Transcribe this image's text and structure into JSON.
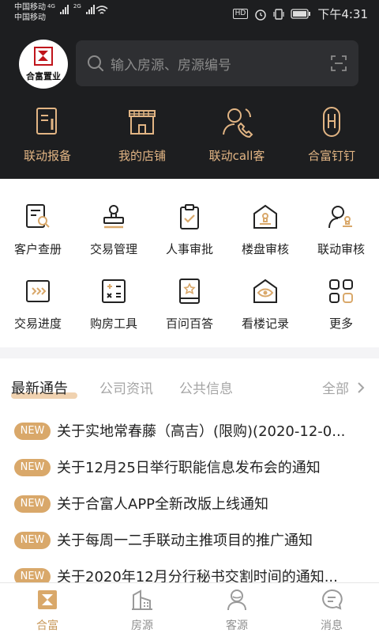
{
  "status_bar": {
    "carrier_1": "中国移动",
    "carrier_2": "中国移动",
    "net_1": "4G",
    "net_2": "2G",
    "hd": "HD",
    "time": "下午4:31"
  },
  "header": {
    "logo_text": "合富置业",
    "search_placeholder": "输入房源、房源编号",
    "quick_actions": [
      {
        "label": "联动报备",
        "icon": "report-icon"
      },
      {
        "label": "我的店铺",
        "icon": "store-icon"
      },
      {
        "label": "联动call客",
        "icon": "call-icon"
      },
      {
        "label": "合富钉钉",
        "icon": "pin-icon"
      }
    ]
  },
  "grid": {
    "row1": [
      {
        "label": "客户查册",
        "icon": "customer-search-icon"
      },
      {
        "label": "交易管理",
        "icon": "stamp-icon"
      },
      {
        "label": "人事审批",
        "icon": "clipboard-check-icon"
      },
      {
        "label": "楼盘审核",
        "icon": "building-review-icon"
      },
      {
        "label": "联动审核",
        "icon": "user-review-icon"
      }
    ],
    "row2": [
      {
        "label": "交易进度",
        "icon": "progress-icon"
      },
      {
        "label": "购房工具",
        "icon": "calculator-icon"
      },
      {
        "label": "百问百答",
        "icon": "book-star-icon"
      },
      {
        "label": "看楼记录",
        "icon": "house-eye-icon"
      },
      {
        "label": "更多",
        "icon": "more-grid-icon"
      }
    ]
  },
  "news": {
    "tabs": [
      "最新通告",
      "公司资讯",
      "公共信息"
    ],
    "all_label": "全部",
    "badge": "NEW",
    "items": [
      "关于实地常春藤（高吉）(限购)(2020-12-0...",
      "关于12月25日举行职能信息发布会的通知",
      "关于合富人APP全新改版上线通知",
      "关于每周一二手联动主推项目的推广通知",
      "关于2020年12月分行秘书交割时间的通知..."
    ]
  },
  "bottom_nav": [
    {
      "label": "合富",
      "icon": "home-logo-icon",
      "active": true
    },
    {
      "label": "房源",
      "icon": "buildings-icon",
      "active": false
    },
    {
      "label": "客源",
      "icon": "person-icon",
      "active": false
    },
    {
      "label": "消息",
      "icon": "message-icon",
      "active": false
    }
  ],
  "colors": {
    "header_bg": "#1d1e20",
    "accent_gold": "#e2b584",
    "badge_gold": "#d9a86a"
  }
}
